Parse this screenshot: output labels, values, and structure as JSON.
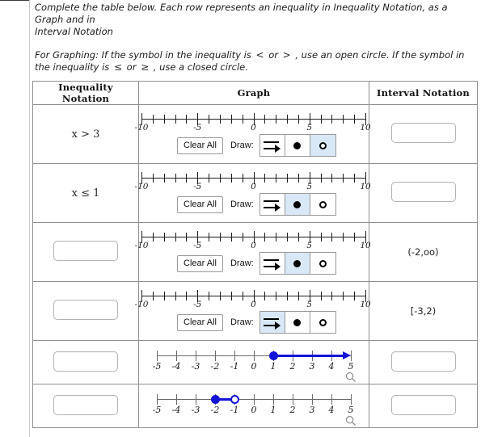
{
  "instructions": {
    "line1_a": "Complete the table below. Each row represents an inequality in Inequality Notation, as a Graph and in",
    "line1_b": "Interval Notation",
    "line2_a": "For Graphing: If the symbol in the inequality is",
    "sym_lt": "<",
    "or_1": "or",
    "sym_gt": ">",
    "line2_b": ", use an open circle. If the symbol in the",
    "line2_c": "inequality is",
    "sym_le": "≤",
    "or_2": "or",
    "sym_ge": "≥",
    "line2_d": ", use a closed circle."
  },
  "table": {
    "headers": [
      "Inequality Notation",
      "Graph",
      "Interval Notation"
    ],
    "graph_tool": {
      "clear_label": "Clear All",
      "draw_label": "Draw:",
      "tools": [
        "ray-tool",
        "closed-dot-tool",
        "open-dot-tool"
      ]
    },
    "axis": {
      "min": -10,
      "max": 10,
      "labels": [
        {
          "value": -10,
          "text": "-10"
        },
        {
          "value": -5,
          "text": "-5"
        },
        {
          "value": 0,
          "text": "0"
        },
        {
          "value": 5,
          "text": "5"
        },
        {
          "value": 10,
          "text": "10"
        }
      ]
    },
    "answer_axis": {
      "min": -5,
      "max": 5,
      "labels": [
        "-5",
        "-4",
        "-3",
        "-2",
        "-1",
        "0",
        "1",
        "2",
        "3",
        "4",
        "5"
      ]
    },
    "rows": [
      {
        "id": "row-1",
        "inequality": "x > 3",
        "inequality_is_input": false,
        "interval": "",
        "interval_is_input": true,
        "graph_type": "tool",
        "active_tool": 2
      },
      {
        "id": "row-2",
        "inequality": "x ≤ 1",
        "inequality_is_input": false,
        "interval": "",
        "interval_is_input": true,
        "graph_type": "tool",
        "active_tool": 1
      },
      {
        "id": "row-3",
        "inequality": "",
        "inequality_is_input": true,
        "interval": "(-2,oo)",
        "interval_is_input": false,
        "graph_type": "tool",
        "active_tool": 1
      },
      {
        "id": "row-4",
        "inequality": "",
        "inequality_is_input": true,
        "interval": "[-3,2)",
        "interval_is_input": false,
        "graph_type": "tool",
        "active_tool": 0
      },
      {
        "id": "row-5",
        "inequality": "",
        "inequality_is_input": true,
        "interval": "",
        "interval_is_input": true,
        "graph_type": "drawn",
        "drawing": {
          "kind": "ray-right",
          "start": 1,
          "start_point": "closed",
          "end": 5,
          "color": "#1414d8"
        }
      },
      {
        "id": "row-6",
        "inequality": "",
        "inequality_is_input": true,
        "interval": "",
        "interval_is_input": true,
        "graph_type": "drawn",
        "drawing": {
          "kind": "segment",
          "start": -2,
          "start_point": "closed",
          "end": -1,
          "end_point": "open",
          "color": "#1414d8"
        }
      }
    ]
  },
  "colors": {
    "graph_accent": "#1414d8",
    "tool_active": "#d9e8f6",
    "border": "#8f8f8f"
  }
}
